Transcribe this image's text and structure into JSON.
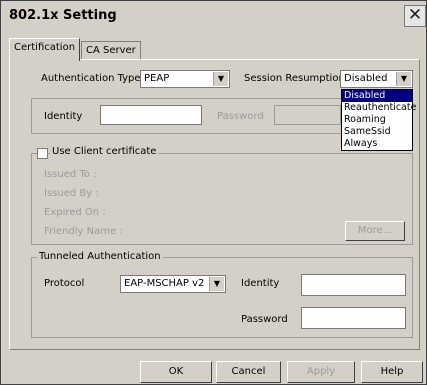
{
  "window": {
    "title": "802.1x Setting"
  },
  "tabs": [
    {
      "label": "Certification"
    },
    {
      "label": "CA Server"
    }
  ],
  "auth": {
    "label": "Authentication Type",
    "value": "PEAP"
  },
  "session": {
    "label": "Session Resumption",
    "value": "Disabled",
    "options": [
      "Disabled",
      "Reauthenticate",
      "Roaming",
      "SameSsid",
      "Always"
    ]
  },
  "identity": {
    "label": "Identity",
    "password_label": "Password"
  },
  "client_cert": {
    "label": "Use Client certificate",
    "issued_to": "Issued To :",
    "issued_by": "Issued By :",
    "expired_on": "Expired On :",
    "friendly_name": "Friendly Name :",
    "more_label": "More..."
  },
  "tunneled": {
    "title": "Tunneled Authentication",
    "protocol_label": "Protocol",
    "protocol_value": "EAP-MSCHAP v2",
    "identity_label": "Identity",
    "password_label": "Password"
  },
  "buttons": {
    "ok": "OK",
    "cancel": "Cancel",
    "apply": "Apply",
    "help": "Help"
  }
}
